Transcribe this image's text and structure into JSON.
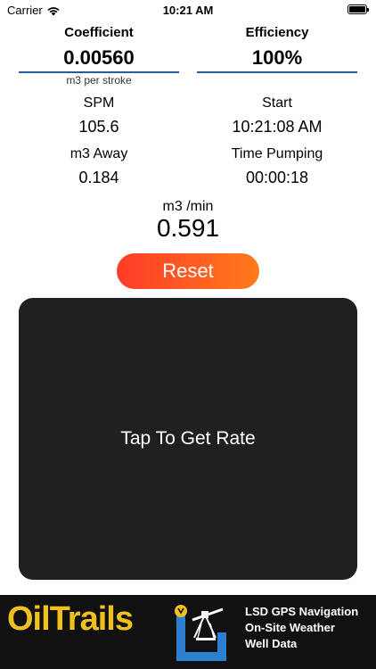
{
  "status": {
    "carrier": "Carrier",
    "time": "10:21 AM"
  },
  "coefficient": {
    "label": "Coefficient",
    "value": "0.00560",
    "unit": "m3 per stroke"
  },
  "efficiency": {
    "label": "Efficiency",
    "value": "100%"
  },
  "stats": {
    "spm_label": "SPM",
    "spm_value": "105.6",
    "start_label": "Start",
    "start_value": "10:21:08 AM",
    "away_label": "m3 Away",
    "away_value": "0.184",
    "pumping_label": "Time Pumping",
    "pumping_value": "00:00:18"
  },
  "rate": {
    "label": "m3 /min",
    "value": "0.591"
  },
  "reset_label": "Reset",
  "tap_label": "Tap To Get Rate",
  "banner": {
    "brand": "OilTrails",
    "lines": [
      "LSD GPS Navigation",
      "On-Site Weather",
      "Well Data"
    ]
  }
}
